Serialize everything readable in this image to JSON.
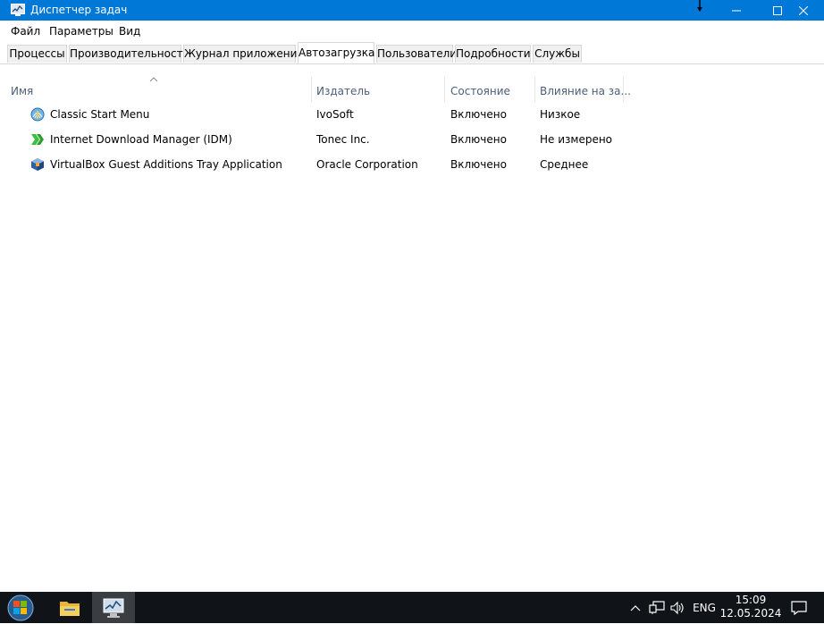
{
  "window": {
    "title": "Диспетчер задач",
    "titlebar_color": "#0078d7",
    "controls": [
      "minimize-icon",
      "maximize-icon",
      "close-icon"
    ]
  },
  "menu": {
    "items": [
      "Файл",
      "Параметры",
      "Вид"
    ]
  },
  "tabs": {
    "items": [
      "Процессы",
      "Производительность",
      "Журнал приложений",
      "Автозагрузка",
      "Пользователи",
      "Подробности",
      "Службы"
    ],
    "active": "Автозагрузка"
  },
  "table": {
    "columns": [
      "Имя",
      "Издатель",
      "Состояние",
      "Влияние на за..."
    ],
    "sorted_by": "Имя",
    "rows": [
      {
        "icon": "classic-start-menu-icon",
        "name": "Classic Start Menu",
        "publisher": "IvoSoft",
        "status": "Включено",
        "impact": "Низкое"
      },
      {
        "icon": "idm-icon",
        "name": "Internet Download Manager (IDM)",
        "publisher": "Tonec Inc.",
        "status": "Включено",
        "impact": "Не измерено"
      },
      {
        "icon": "virtualbox-icon",
        "name": "VirtualBox Guest Additions Tray Application",
        "publisher": "Oracle Corporation",
        "status": "Включено",
        "impact": "Среднее"
      }
    ]
  },
  "taskbar": {
    "background": "#101317",
    "apps": [
      "start-orb-icon",
      "file-explorer-icon",
      "task-manager-icon"
    ],
    "tray": {
      "icons": [
        "chevron-up-icon",
        "network-icon",
        "volume-icon"
      ],
      "language": "ENG",
      "time": "15:09",
      "date": "12.05.2024",
      "notification_icon": "action-center-icon"
    }
  }
}
